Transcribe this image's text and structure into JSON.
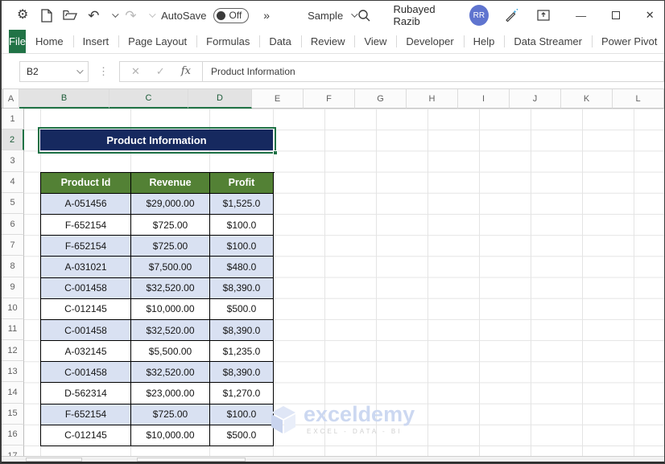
{
  "titlebar": {
    "autosave_label": "AutoSave",
    "autosave_state": "Off",
    "more_commands_glyph": "»",
    "document_name": "Sample",
    "user_name": "Rubayed Razib",
    "avatar_initials": "RR",
    "icons": {
      "gear": "⚙",
      "undo": "↶",
      "redo": "↷",
      "minimize": "—",
      "close": "✕"
    }
  },
  "ribbon": {
    "file_tab": "File",
    "tabs": [
      "Home",
      "Insert",
      "Page Layout",
      "Formulas",
      "Data",
      "Review",
      "View",
      "Developer",
      "Help",
      "Data Streamer",
      "Power Pivot"
    ]
  },
  "formula_bar": {
    "name_box": "B2",
    "dots_glyph": "⋮",
    "cancel_glyph": "✕",
    "enter_glyph": "✓",
    "fx_label": "fx",
    "formula": "Product Information"
  },
  "sheet": {
    "column_headers": [
      "A",
      "B",
      "C",
      "D",
      "E",
      "F",
      "G",
      "H",
      "I",
      "J",
      "K",
      "L"
    ],
    "selected_columns": [
      "B",
      "C",
      "D"
    ],
    "row_headers": [
      1,
      2,
      3,
      4,
      5,
      6,
      7,
      8,
      9,
      10,
      11,
      12,
      13,
      14,
      15,
      16,
      17
    ],
    "selected_row": 2,
    "title_cell": {
      "cell": "B2",
      "text": "Product Information"
    },
    "table": {
      "headers": [
        "Product Id",
        "Revenue",
        "Profit"
      ],
      "rows": [
        {
          "product_id": "A-051456",
          "revenue": "$29,000.00",
          "profit": "$1,525.0",
          "shaded": true
        },
        {
          "product_id": "F-652154",
          "revenue": "$725.00",
          "profit": "$100.0",
          "shaded": false
        },
        {
          "product_id": "F-652154",
          "revenue": "$725.00",
          "profit": "$100.0",
          "shaded": true
        },
        {
          "product_id": "A-031021",
          "revenue": "$7,500.00",
          "profit": "$480.0",
          "shaded": true
        },
        {
          "product_id": "C-001458",
          "revenue": "$32,520.00",
          "profit": "$8,390.0",
          "shaded": true
        },
        {
          "product_id": "C-012145",
          "revenue": "$10,000.00",
          "profit": "$500.0",
          "shaded": false
        },
        {
          "product_id": "C-001458",
          "revenue": "$32,520.00",
          "profit": "$8,390.0",
          "shaded": true
        },
        {
          "product_id": "A-032145",
          "revenue": "$5,500.00",
          "profit": "$1,235.0",
          "shaded": false
        },
        {
          "product_id": "C-001458",
          "revenue": "$32,520.00",
          "profit": "$8,390.0",
          "shaded": true
        },
        {
          "product_id": "D-562314",
          "revenue": "$23,000.00",
          "profit": "$1,270.0",
          "shaded": false
        },
        {
          "product_id": "F-652154",
          "revenue": "$725.00",
          "profit": "$100.0",
          "shaded": true
        },
        {
          "product_id": "C-012145",
          "revenue": "$10,000.00",
          "profit": "$500.0",
          "shaded": false
        }
      ]
    }
  },
  "watermark": {
    "brand": "exceldemy",
    "tagline": "EXCEL - DATA - BI"
  },
  "colors": {
    "excel_green": "#217346",
    "table_header_green": "#538135",
    "title_cell_navy": "#16295f",
    "shaded_row_blue": "#d9e1f2",
    "avatar_blue": "#5f74cf"
  }
}
